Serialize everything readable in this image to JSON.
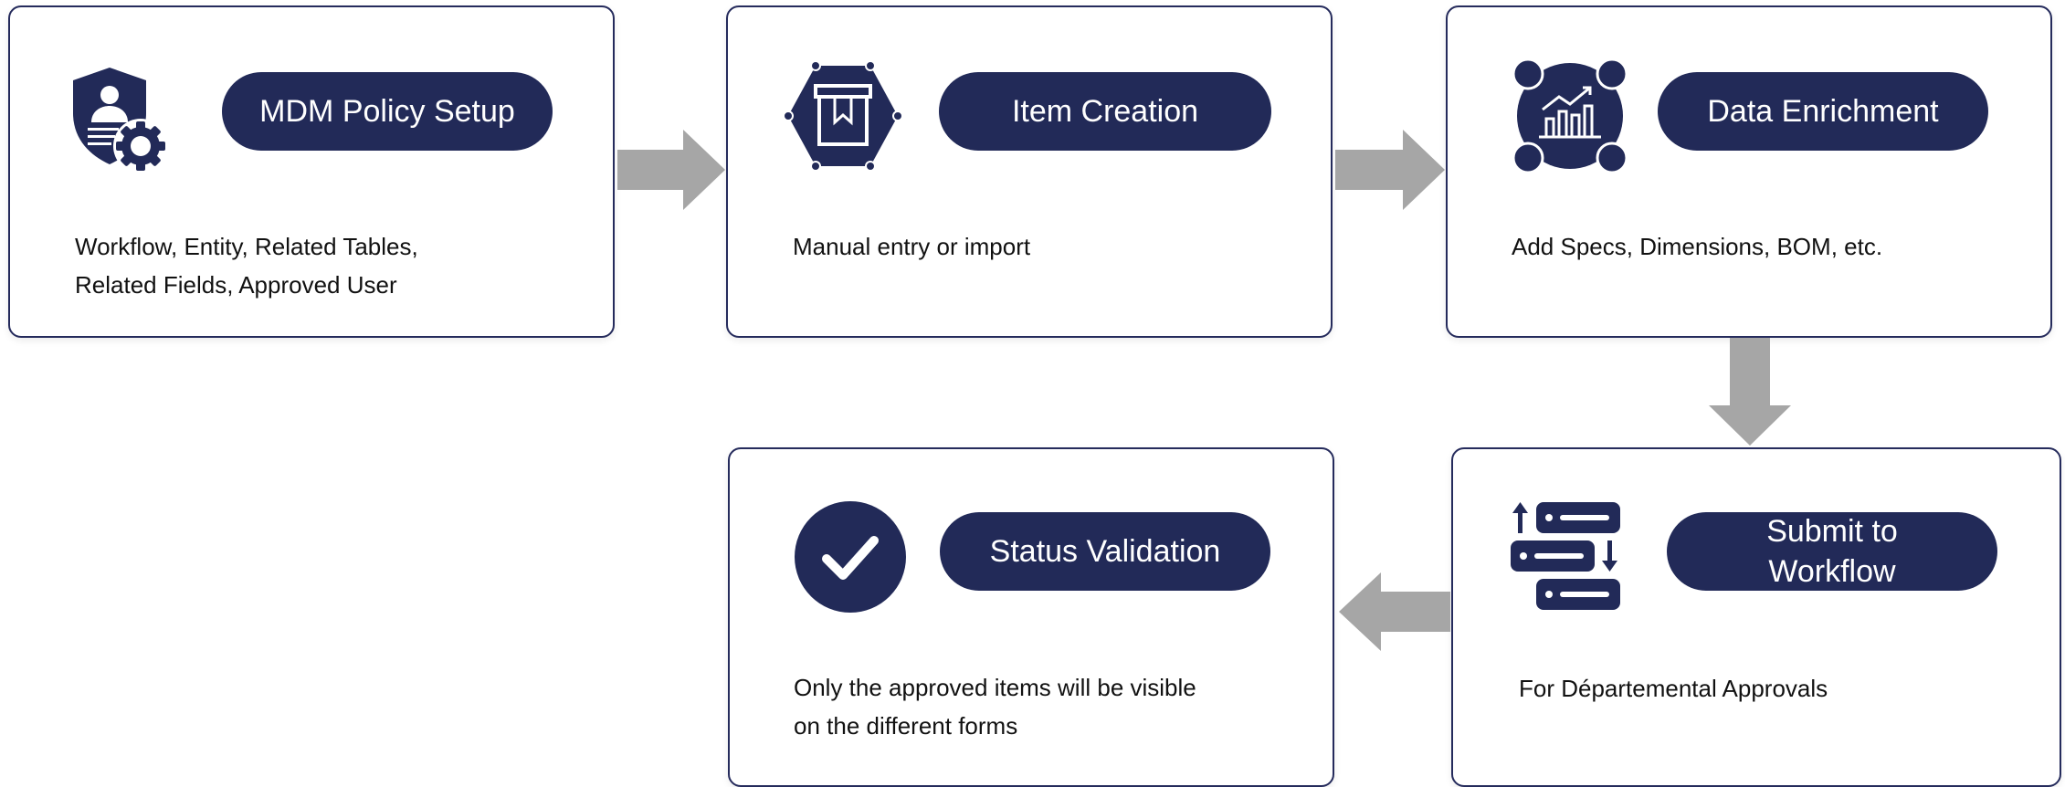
{
  "steps": [
    {
      "title": "MDM Policy Setup",
      "description_lines": [
        "Workflow, Entity, Related Tables,",
        "Related Fields, Approved User"
      ],
      "icon": "shield-user-gear-icon"
    },
    {
      "title": "Item Creation",
      "description_lines": [
        "Manual entry or import"
      ],
      "icon": "box-hexagon-icon"
    },
    {
      "title": "Data Enrichment",
      "description_lines": [
        "Add Specs, Dimensions, BOM, etc."
      ],
      "icon": "chart-network-icon"
    },
    {
      "title_lines": [
        "Submit to",
        "Workflow"
      ],
      "description_lines": [
        "For Départemental Approvals"
      ],
      "icon": "server-sort-icon"
    },
    {
      "title": "Status Validation",
      "description_lines": [
        "Only the approved items will be visible",
        "on the different forms"
      ],
      "icon": "checkmark-circle-icon"
    }
  ],
  "colors": {
    "navy": "#222a58",
    "border": "#252b5c",
    "arrow": "#a6a6a6",
    "text": "#111111"
  }
}
